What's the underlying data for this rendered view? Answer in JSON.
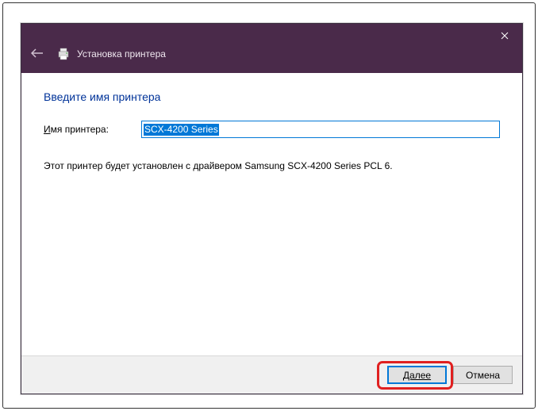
{
  "titlebar": {
    "title": "Установка принтера"
  },
  "content": {
    "heading": "Введите имя принтера",
    "label_prefix": "И",
    "label_rest": "мя принтера:",
    "input_value": "SCX-4200 Series",
    "info": "Этот принтер будет установлен с драйвером Samsung SCX-4200 Series PCL 6."
  },
  "buttons": {
    "next": "Далее",
    "cancel": "Отмена"
  }
}
